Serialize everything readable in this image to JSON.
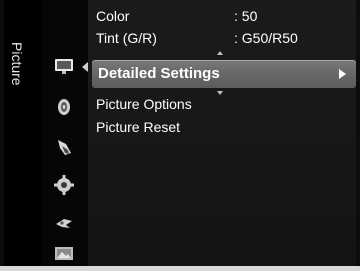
{
  "sidebar": {
    "section_label": "Picture",
    "icons": [
      {
        "name": "picture-icon",
        "active": true
      },
      {
        "name": "sound-icon",
        "active": false
      },
      {
        "name": "channel-icon",
        "active": false
      },
      {
        "name": "setup-icon",
        "active": false
      },
      {
        "name": "input-icon",
        "active": false
      },
      {
        "name": "application-icon",
        "active": false
      }
    ]
  },
  "menu": {
    "items": [
      {
        "label": "Color",
        "value": ": 50"
      },
      {
        "label": "Tint (G/R)",
        "value": ": G50/R50"
      },
      {
        "label": "Detailed Settings",
        "selected": true
      },
      {
        "label": "Picture Options"
      },
      {
        "label": "Picture Reset"
      }
    ]
  },
  "colors": {
    "selected_bar": "#6e6e6e",
    "background": "#141414",
    "text": "#ffffff"
  }
}
